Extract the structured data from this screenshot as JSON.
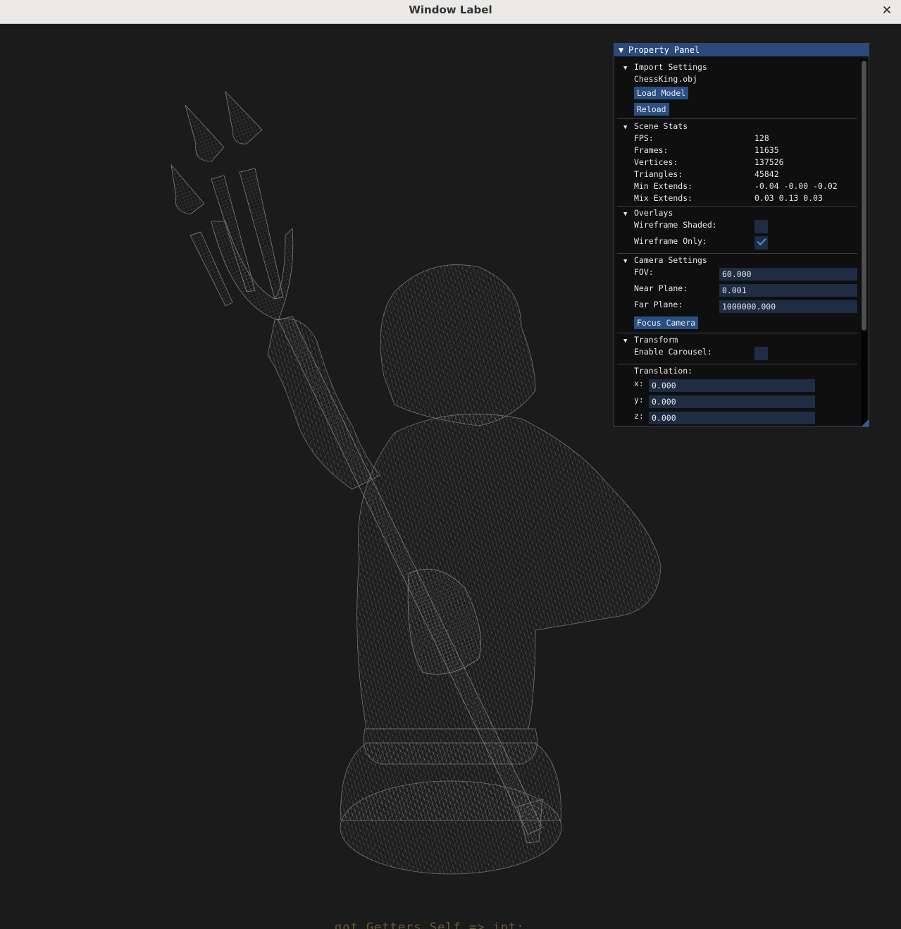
{
  "window": {
    "title": "Window Label",
    "close_glyph": "✕"
  },
  "background_code": "got.Getters.Self => int;",
  "panel": {
    "title": "Property Panel",
    "import_settings": {
      "title": "Import Settings",
      "filename": "ChessKing.obj",
      "load_button": "Load Model",
      "reload_button": "Reload"
    },
    "scene_stats": {
      "title": "Scene Stats",
      "rows": [
        {
          "label": "FPS:",
          "value": "128"
        },
        {
          "label": "Frames:",
          "value": "11635"
        },
        {
          "label": "Vertices:",
          "value": "137526"
        },
        {
          "label": "Triangles:",
          "value": "45842"
        },
        {
          "label": "Min Extends:",
          "value": "-0.04 -0.00 -0.02"
        },
        {
          "label": "Mix Extends:",
          "value": "0.03 0.13 0.03"
        }
      ]
    },
    "overlays": {
      "title": "Overlays",
      "wireframe_shaded_label": "Wireframe Shaded:",
      "wireframe_shaded_checked": false,
      "wireframe_only_label": "Wireframe Only:",
      "wireframe_only_checked": true
    },
    "camera_settings": {
      "title": "Camera Settings",
      "fov_label": "FOV:",
      "fov_value": "60.000",
      "near_label": "Near Plane:",
      "near_value": "0.001",
      "far_label": "Far Plane:",
      "far_value": "1000000.000",
      "focus_button": "Focus Camera"
    },
    "transform": {
      "title": "Transform",
      "carousel_label": "Enable Carousel:",
      "carousel_checked": false,
      "translation_label": "Translation:",
      "x_label": "x:",
      "x_value": "0.000",
      "y_label": "y:",
      "y_value": "0.000",
      "z_label": "z:",
      "z_value": "0.000"
    }
  },
  "colors": {
    "viewport_bg": "#1b1b1b",
    "wire": "#8a8a8a",
    "panel_header": "#294a7a",
    "button": "#2a4f82",
    "field_bg": "#1e2d44",
    "check": "#4a90e2"
  }
}
